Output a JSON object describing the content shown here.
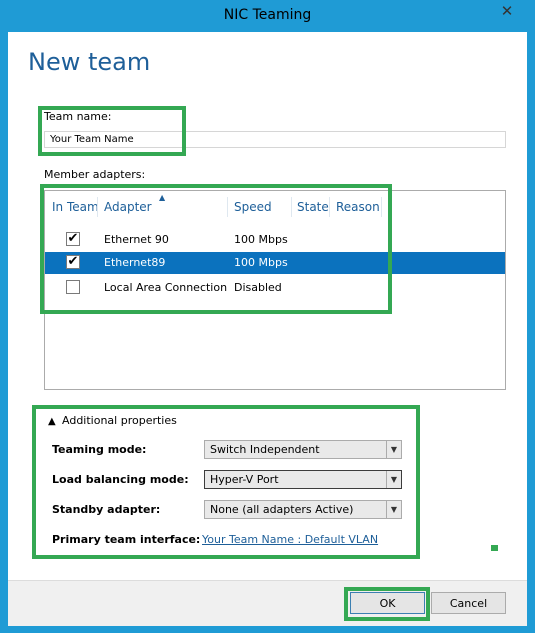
{
  "window": {
    "title": "NIC Teaming",
    "close_glyph": "✕"
  },
  "heading": "New team",
  "team_name": {
    "label": "Team name:",
    "value": "Your Team Name"
  },
  "member_adapters": {
    "label": "Member adapters:",
    "columns": [
      "In Team",
      "Adapter",
      "Speed",
      "State",
      "Reason"
    ],
    "sort_glyph": "▲",
    "rows": [
      {
        "checked": true,
        "adapter": "Ethernet 90",
        "speed": "100 Mbps",
        "state": "",
        "reason": ""
      },
      {
        "checked": true,
        "adapter": "Ethernet89",
        "speed": "100 Mbps",
        "state": "",
        "reason": "",
        "selected": true
      },
      {
        "checked": false,
        "adapter": "Local Area Connection",
        "speed": "Disabled",
        "state": "",
        "reason": ""
      }
    ],
    "check_glyph": "✔"
  },
  "additional_properties": {
    "toggle_label": "Additional properties",
    "toggle_glyph": "▲",
    "teaming_mode": {
      "label": "Teaming mode:",
      "value": "Switch Independent"
    },
    "load_balancing_mode": {
      "label": "Load balancing mode:",
      "value": "Hyper-V Port"
    },
    "standby_adapter": {
      "label": "Standby adapter:",
      "value": "None (all adapters Active)"
    },
    "primary_team_interface": {
      "label": "Primary team interface:",
      "value": "Your Team Name : Default VLAN"
    },
    "dropdown_glyph": "▼"
  },
  "footer": {
    "ok_label": "OK",
    "cancel_label": "Cancel"
  },
  "colors": {
    "accent": "#1f9bd5",
    "highlight": "#34a853",
    "selection": "#0b72be",
    "heading": "#1e5f99"
  }
}
